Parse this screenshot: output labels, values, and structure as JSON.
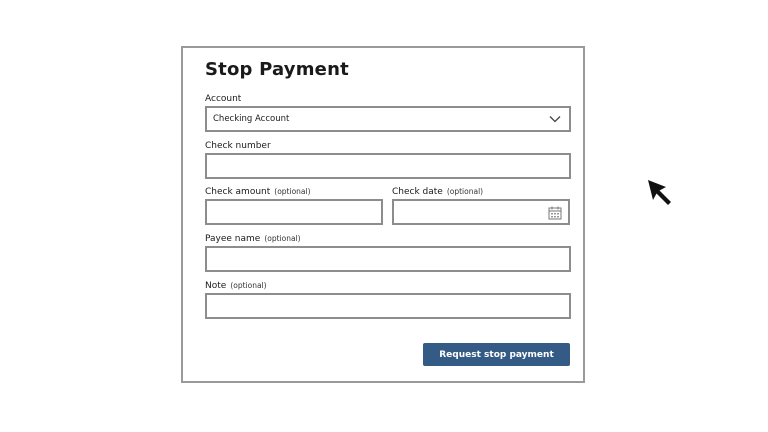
{
  "form": {
    "title": "Stop Payment",
    "account": {
      "label": "Account",
      "selected": "Checking Account"
    },
    "check_number": {
      "label": "Check number",
      "value": ""
    },
    "check_amount": {
      "label": "Check amount",
      "optional": "(optional)",
      "value": ""
    },
    "check_date": {
      "label": "Check date",
      "optional": "(optional)",
      "value": ""
    },
    "payee_name": {
      "label": "Payee name",
      "optional": "(optional)",
      "value": ""
    },
    "note": {
      "label": "Note",
      "optional": "(optional)",
      "value": ""
    },
    "submit_label": "Request stop payment"
  },
  "icons": {
    "account_dropdown": "chevron-down-icon",
    "date_picker": "calendar-icon",
    "pointer": "mouse-cursor-icon"
  },
  "colors": {
    "primary_button": "#345a86",
    "field_border": "#8d8d8d",
    "panel_border": "#9a9a9a"
  }
}
